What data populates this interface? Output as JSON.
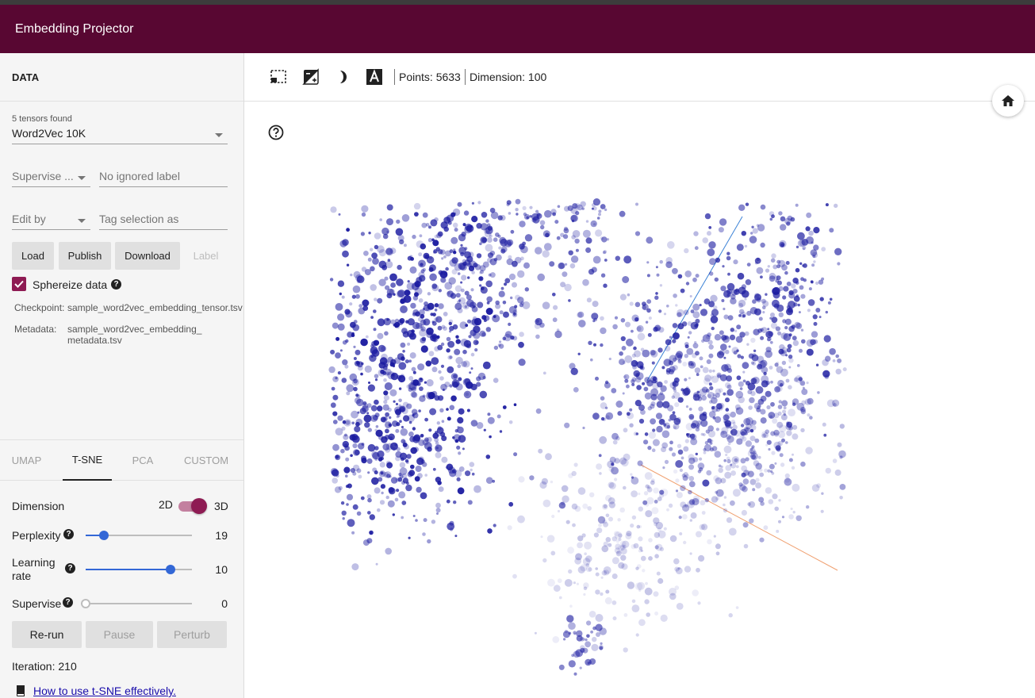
{
  "app": {
    "title": "Embedding Projector"
  },
  "data_panel": {
    "header": "DATA",
    "tensor_caption": "5 tensors found",
    "tensor_select": "Word2Vec 10K",
    "supervise_select": "Supervise ...",
    "ignored_label_placeholder": "No ignored label",
    "edit_by_select": "Edit by",
    "tag_selection_placeholder": "Tag selection as",
    "buttons": {
      "load": "Load",
      "publish": "Publish",
      "download": "Download",
      "label": "Label"
    },
    "sphereize_label": "Sphereize data",
    "checkpoint_label": "Checkpoint:",
    "checkpoint_value": "sample_word2vec_embedding_tensor.tsv",
    "metadata_label": "Metadata:",
    "metadata_value_1": "sample_word2vec_embedding_",
    "metadata_value_2": "metadata.tsv"
  },
  "tabs": [
    {
      "label": "UMAP",
      "active": false
    },
    {
      "label": "T-SNE",
      "active": true
    },
    {
      "label": "PCA",
      "active": false
    },
    {
      "label": "CUSTOM",
      "active": false
    }
  ],
  "tsne": {
    "dimension_label": "Dimension",
    "dim_2d": "2D",
    "dim_3d": "3D",
    "perplexity_label": "Perplexity",
    "perplexity_value": "19",
    "perplexity_fraction": 0.17,
    "learning_rate_label_1": "Learning",
    "learning_rate_label_2": "rate",
    "learning_rate_value": "10",
    "learning_rate_fraction": 0.8,
    "supervise_label": "Supervise",
    "supervise_value": "0",
    "supervise_fraction": 0.0,
    "rerun": "Re-run",
    "pause": "Pause",
    "perturb": "Perturb",
    "iteration": "Iteration: 210",
    "help_link": "How to use t-SNE effectively."
  },
  "toolbar": {
    "points": "Points: 5633",
    "dimension": "Dimension: 100"
  },
  "colors": {
    "app_bar": "#580732",
    "accent": "#8e1b53",
    "slider": "#3367d6",
    "point": "#1a1aa0"
  }
}
